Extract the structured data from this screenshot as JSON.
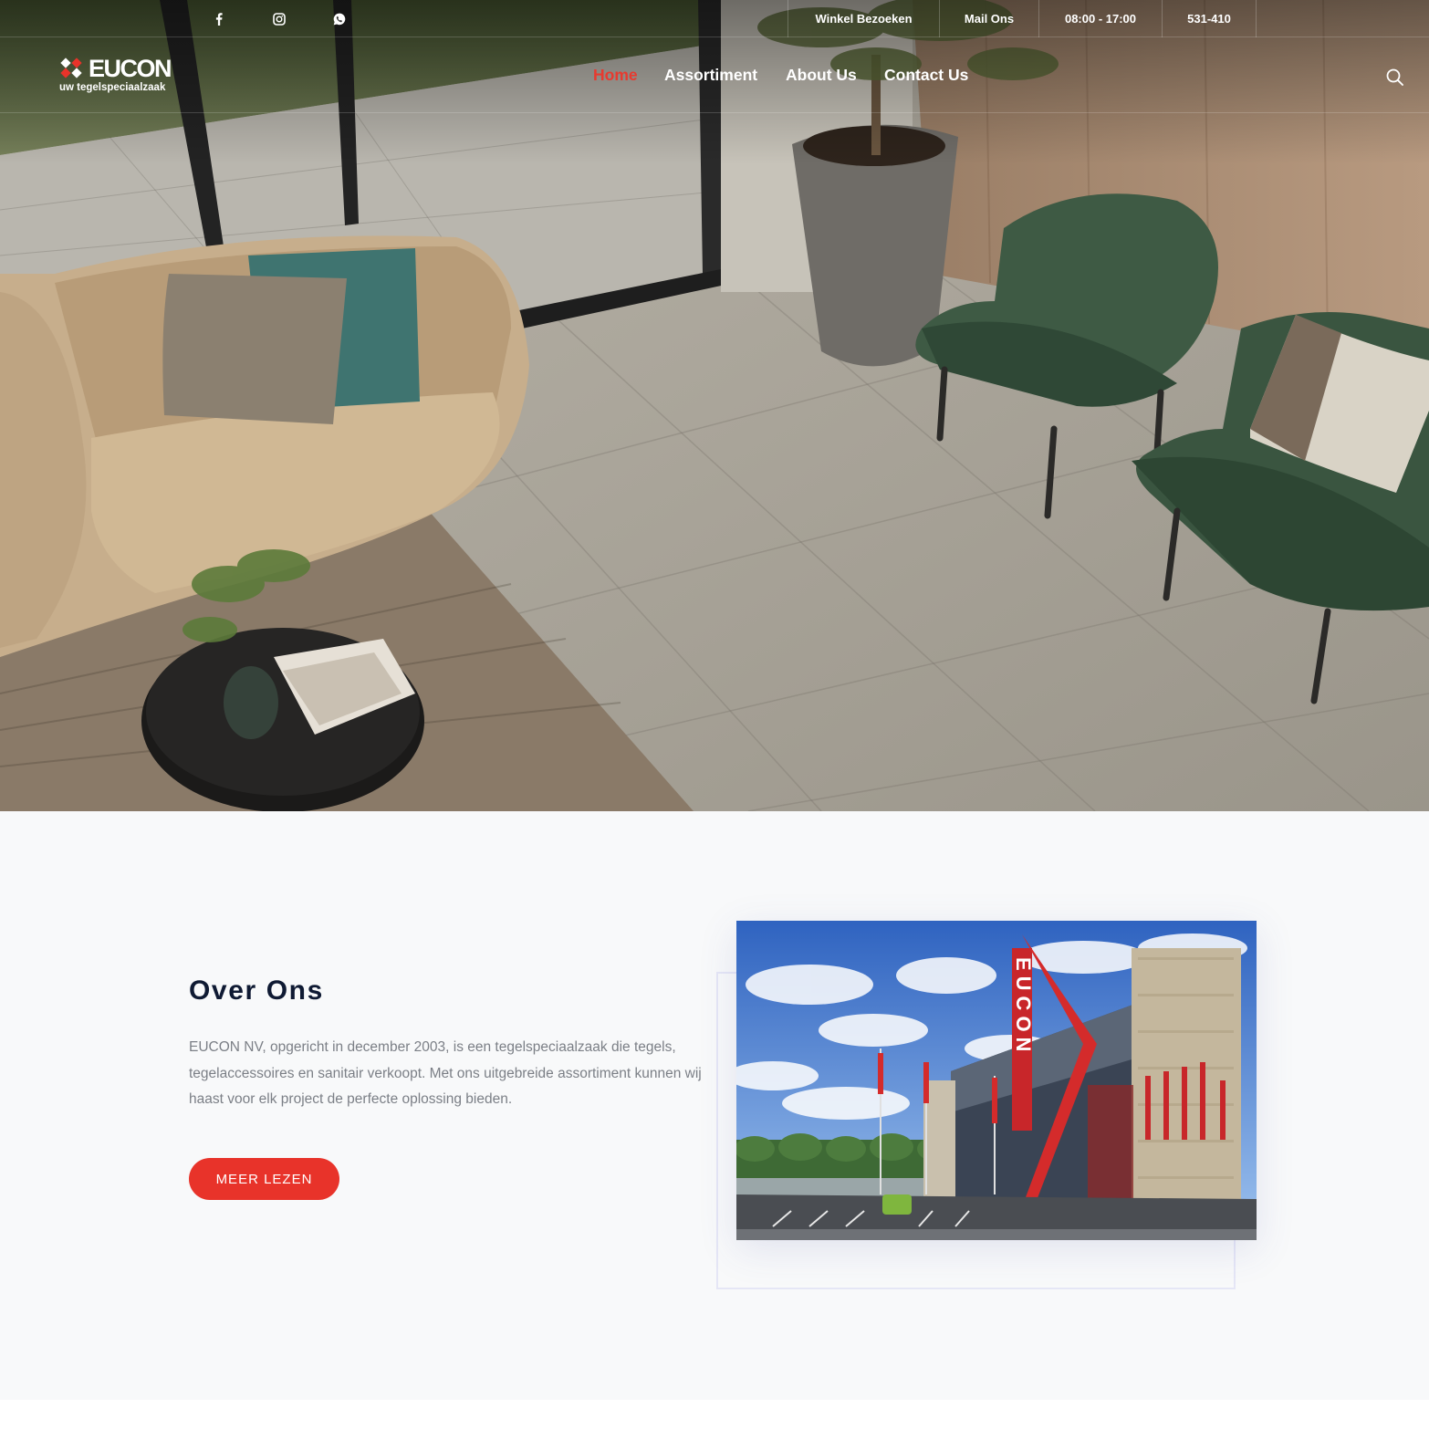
{
  "colors": {
    "accent": "#e8332a",
    "heading": "#0f1a33",
    "body_text": "#7b7f86",
    "frame": "#e5e6f6"
  },
  "topbar": {
    "social_icons": [
      "facebook-icon",
      "instagram-icon",
      "whatsapp-icon"
    ],
    "visit_label": "Winkel Bezoeken",
    "mail_label": "Mail Ons",
    "hours_label": "08:00 - 17:00",
    "phone_label": "531-410"
  },
  "header": {
    "logo_text": "EUCON",
    "logo_tagline": "uw tegelspeciaalzaak",
    "nav": {
      "home": "Home",
      "assortment": "Assortiment",
      "about": "About Us",
      "contact": "Contact Us"
    },
    "active_nav": "Home",
    "search_icon": "search-icon"
  },
  "about": {
    "title": "Over Ons",
    "text": "EUCON NV, opgericht in december 2003, is een tegelspeciaalzaak die tegels, tegelaccessoires en sanitair verkoopt. Met ons uitgebreide assortiment kunnen wij haast voor elk project de perfecte oplossing bieden.",
    "button_label": "MEER LEZEN",
    "sign_text": "EUCON"
  }
}
